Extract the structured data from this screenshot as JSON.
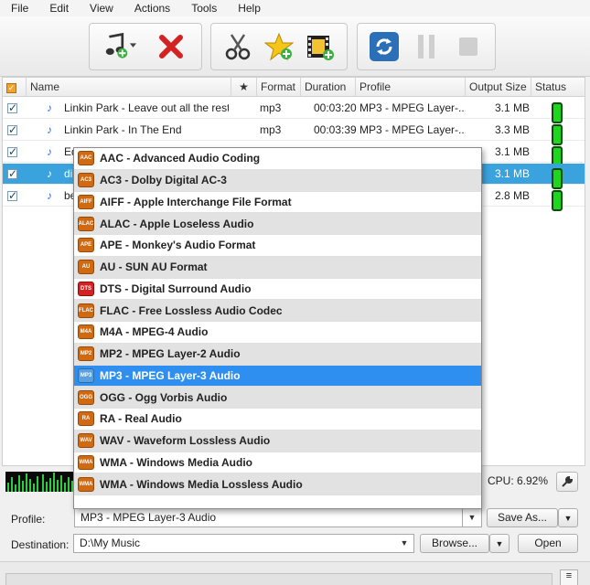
{
  "menu": [
    "File",
    "Edit",
    "View",
    "Actions",
    "Tools",
    "Help"
  ],
  "toolbar": {
    "add_files": "add-music-files",
    "remove": "remove-files",
    "cut": "cut-audio",
    "favorite": "add-to-favorites",
    "add_video": "add-video",
    "convert": "convert",
    "pause": "pause",
    "stop": "stop"
  },
  "columns": {
    "name": "Name",
    "star": "★",
    "format": "Format",
    "duration": "Duration",
    "profile": "Profile",
    "output_size": "Output Size",
    "status": "Status"
  },
  "rows": [
    {
      "name": "Linkin Park - Leave out all the rest",
      "format": "mp3",
      "duration": "00:03:20",
      "profile": "MP3 - MPEG Layer-...",
      "size": "3.1 MB",
      "checked": "✓",
      "selected": false
    },
    {
      "name": "Linkin Park - In The End",
      "format": "mp3",
      "duration": "00:03:39",
      "profile": "MP3 - MPEG Layer-...",
      "size": "3.3 MB",
      "checked": "✓",
      "selected": false
    },
    {
      "name": "Ed",
      "format": "",
      "duration": "",
      "profile": "",
      "size": "3.1 MB",
      "checked": "✓",
      "selected": false
    },
    {
      "name": "di",
      "format": "",
      "duration": "",
      "profile": "",
      "size": "3.1 MB",
      "checked": "✓",
      "selected": true
    },
    {
      "name": "be",
      "format": "",
      "duration": "",
      "profile": "",
      "size": "2.8 MB",
      "checked": "✓",
      "selected": false
    }
  ],
  "formats": [
    {
      "icon": "AAC",
      "label": "AAC - Advanced Audio Coding"
    },
    {
      "icon": "AC3",
      "label": "AC3 - Dolby Digital AC-3"
    },
    {
      "icon": "AIFF",
      "label": "AIFF - Apple Interchange File Format"
    },
    {
      "icon": "ALAC",
      "label": "ALAC - Apple Loseless Audio"
    },
    {
      "icon": "APE",
      "label": "APE - Monkey's Audio Format"
    },
    {
      "icon": "AU",
      "label": "AU - SUN AU Format"
    },
    {
      "icon": "DTS",
      "label": "DTS - Digital Surround Audio"
    },
    {
      "icon": "FLAC",
      "label": "FLAC - Free Lossless Audio Codec"
    },
    {
      "icon": "M4A",
      "label": "M4A - MPEG-4 Audio"
    },
    {
      "icon": "MP2",
      "label": "MP2 - MPEG Layer-2 Audio"
    },
    {
      "icon": "MP3",
      "label": "MP3 - MPEG Layer-3 Audio"
    },
    {
      "icon": "OGG",
      "label": "OGG - Ogg Vorbis Audio"
    },
    {
      "icon": "RA",
      "label": "RA - Real Audio"
    },
    {
      "icon": "WAV",
      "label": "WAV - Waveform Lossless Audio"
    },
    {
      "icon": "WMA",
      "label": "WMA - Windows Media Audio"
    },
    {
      "icon": "WMA",
      "label": "WMA - Windows Media Lossless Audio"
    }
  ],
  "highlighted_format_index": 10,
  "cpu": "CPU: 6.92%",
  "profile": {
    "label": "Profile:",
    "value": "MP3 - MPEG Layer-3 Audio",
    "save_as": "Save As..."
  },
  "destination": {
    "label": "Destination:",
    "value": "D:\\My Music",
    "browse": "Browse...",
    "open": "Open"
  },
  "colors": {
    "selection": "#3aa3de",
    "highlight": "#2f8ff0",
    "status_ok": "#1ed61e",
    "format_icon": "#d06a12"
  }
}
